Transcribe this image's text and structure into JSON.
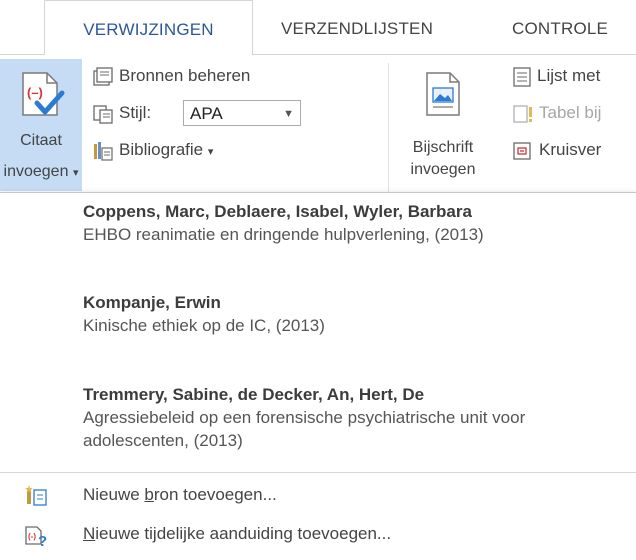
{
  "tabs": [
    {
      "label": "VERWIJZINGEN",
      "active": true
    },
    {
      "label": "VERZENDLIJSTEN",
      "active": false
    },
    {
      "label": "CONTROLE",
      "active": false
    }
  ],
  "ribbon": {
    "citaat": {
      "line1": "Citaat",
      "line2": "invoegen",
      "caret": "▾"
    },
    "bronnen_beheren": "Bronnen beheren",
    "stijl_label": "Stijl:",
    "stijl_value": "APA",
    "bibliografie": "Bibliografie",
    "bibliografie_caret": "▾",
    "bijschrift": {
      "line1": "Bijschrift",
      "line2": "invoegen"
    },
    "lijst_met": "Lijst met",
    "tabel_bij": "Tabel bij",
    "kruisver": "Kruisver"
  },
  "sources": [
    {
      "authors": "Coppens, Marc, Deblaere, Isabel,  Wyler, Barbara",
      "detail": "EHBO reanimatie en dringende hulpverlening, (2013)"
    },
    {
      "authors": "Kompanje, Erwin",
      "detail": "Kinische ethiek op de IC, (2013)"
    },
    {
      "authors": "Tremmery, Sabine, de Decker, An,  Hert, De",
      "detail": "Agressiebeleid op een forensische psychiatrische unit voor adolescenten, (2013)"
    }
  ],
  "menu": {
    "new_source": {
      "before": "Nieuwe ",
      "accel": "b",
      "after": "ron toevoegen..."
    },
    "new_placeholder": {
      "before": "",
      "accel": "N",
      "after": "ieuwe tijdelijke aanduiding toevoegen..."
    }
  },
  "colors": {
    "accent": "#2b579a",
    "pressed": "#c5dcf4",
    "checkmark": "#2b7bd2",
    "cite_red": "#d13438"
  }
}
